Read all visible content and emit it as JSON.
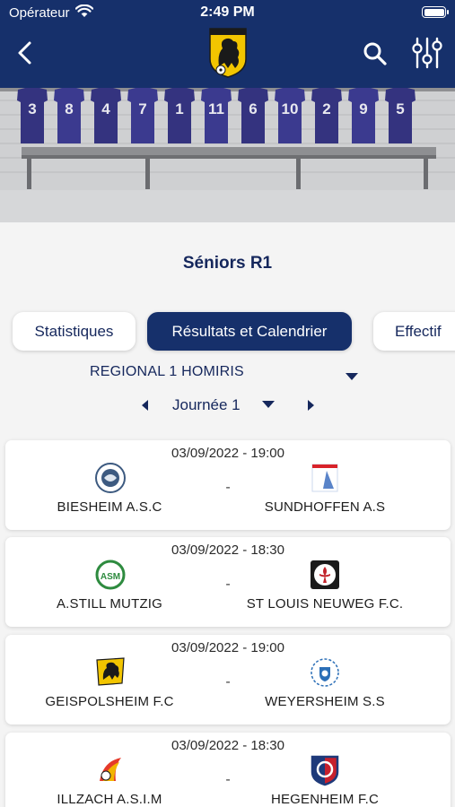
{
  "status_bar": {
    "carrier": "Opérateur",
    "time": "2:49 PM"
  },
  "header": {
    "logo": "geispolsheim-fc-logo",
    "icons": [
      "back-icon",
      "search-icon",
      "filter-sliders-icon"
    ]
  },
  "banner": {
    "jersey_numbers": [
      "3",
      "8",
      "4",
      "7",
      "1",
      "11",
      "6",
      "10",
      "2",
      "9",
      "5"
    ]
  },
  "team_title": "Séniors R1",
  "tabs": [
    {
      "label": "Statistiques",
      "active": false
    },
    {
      "label": "Résultats et Calendrier",
      "active": true
    },
    {
      "label": "Effectif",
      "active": false
    }
  ],
  "competition": {
    "selected": "REGIONAL 1 HOMIRIS"
  },
  "round": {
    "selected": "Journée 1"
  },
  "matches": [
    {
      "date": "03/09/2022 - 19:00",
      "home": "BIESHEIM A.S.C",
      "away": "SUNDHOFFEN A.S",
      "score": "-"
    },
    {
      "date": "03/09/2022 - 18:30",
      "home": "A.STILL MUTZIG",
      "away": "ST LOUIS NEUWEG F.C.",
      "score": "-"
    },
    {
      "date": "03/09/2022 - 19:00",
      "home": "GEISPOLSHEIM F.C",
      "away": "WEYERSHEIM S.S",
      "score": "-"
    },
    {
      "date": "03/09/2022 - 18:30",
      "home": "ILLZACH A.S.I.M",
      "away": "HEGENHEIM F.C",
      "score": "-"
    }
  ],
  "colors": {
    "primary": "#16306b",
    "title": "#15275c",
    "background": "#f4f4f4",
    "card": "#ffffff"
  }
}
